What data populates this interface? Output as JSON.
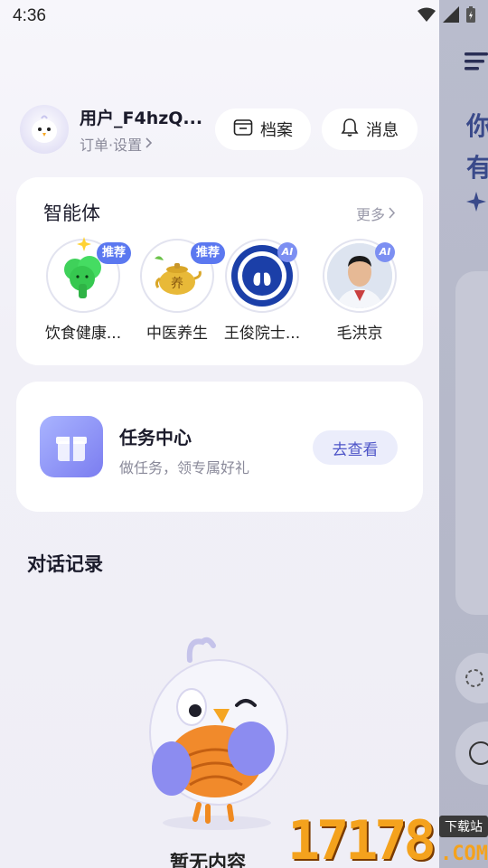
{
  "status_bar": {
    "time": "4:36"
  },
  "user": {
    "name": "用户_F4hzQ...",
    "subtitle": "订单·设置"
  },
  "header_buttons": {
    "archive_label": "档案",
    "messages_label": "消息"
  },
  "agents_section": {
    "title": "智能体",
    "more_label": "更多",
    "items": [
      {
        "label": "饮食健康...",
        "badge": "推荐"
      },
      {
        "label": "中医养生",
        "badge": "推荐",
        "icon_text": "养"
      },
      {
        "label": "王俊院士...",
        "badge": "AI"
      },
      {
        "label": "毛洪京",
        "badge": "AI"
      }
    ]
  },
  "task_center": {
    "title": "任务中心",
    "subtitle": "做任务，领专属好礼",
    "button_label": "去查看"
  },
  "history": {
    "title": "对话记录",
    "empty_text": "暂无内容"
  },
  "background_page": {
    "line1": "你",
    "line2": "有"
  },
  "watermark": {
    "digits": "17178",
    "tag": "下载站",
    "suffix": ".COM"
  },
  "colors": {
    "accent": "#5b78f0",
    "task_button_text": "#4e55c8",
    "watermark": "#f4a21d"
  }
}
